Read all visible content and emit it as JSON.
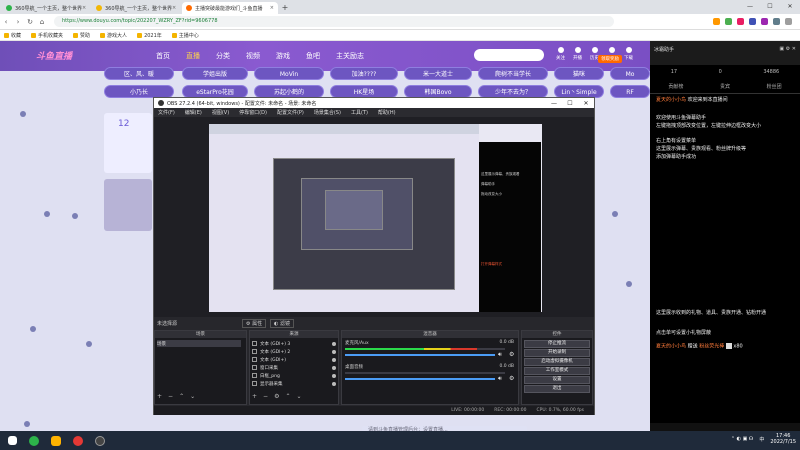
{
  "browser": {
    "tabs": [
      {
        "title": "360导航_一个主页，整个世界",
        "color": "#2db34a"
      },
      {
        "title": "360导航_一个主页，整个世界",
        "color": "#f2b705"
      },
      {
        "title": "主播突破最能游戏们_斗鱼直播",
        "color": "#ff6a00"
      }
    ],
    "url": "https://www.douyu.com/topic/202207_WZRY_ZF?rid=9606778",
    "bookmarks": [
      "收藏",
      "手机收藏夹",
      "赞助",
      "游戏大人",
      "2021年",
      "主播中心"
    ]
  },
  "site": {
    "logo": "斗鱼直播",
    "nav": [
      "首页",
      "直播",
      "分类",
      "视频",
      "游戏",
      "鱼吧",
      "主关励志"
    ],
    "nav_active_index": 1,
    "search_placeholder": "",
    "header_icons": [
      "关注",
      "开播",
      "历史",
      "任务",
      "下载"
    ],
    "open_label": "领取奖励",
    "tags_row1": [
      "区、风、暖",
      "学姐出版",
      "MoVin",
      "加油????",
      "米一大道士",
      "爬树不当学长",
      "猫咪",
      "Mo"
    ],
    "tags_row2": [
      "小乃长",
      "eStarPro花园",
      "苏起小鹤的",
      "HK星场",
      "韩国Bovo",
      "少年不去为？",
      "Lin丶Simple",
      "RF"
    ],
    "card_number": "12"
  },
  "chat": {
    "title": "冰霜助手",
    "stats": [
      "17",
      "0",
      "34886"
    ],
    "tabs": [
      "贡献榜",
      "贵宾",
      "粉丝团"
    ],
    "welcome_user": "夏天的小小鸟",
    "welcome_text": "欢迎来到本直播间",
    "messages": [
      "欢迎使用斗鱼弹幕助手",
      "左键拖拽顶部改变位置，左键拉伸边框改变大小",
      "右上角有设置菜单",
      "这里展示弹幕、贵族观看、粉丝牌升级等",
      "添加弹幕助手成功"
    ],
    "gift_note_1": "这里展示收到的礼物、道具、贵族开通、钻粉开通",
    "gift_note_2": "点击单可设置小礼物屏蔽",
    "gift_user": "夏天的小小鸟",
    "gift_action": "赠送",
    "gift_item": "粉丝荧光棒",
    "gift_count": "x80"
  },
  "obs": {
    "title": "OBS 27.2.4 (64-bit, windows) - 配置文件: 未命名 - 场景: 未命名",
    "menu": [
      "文件(F)",
      "编辑(E)",
      "视图(V)",
      "停靠窗口(D)",
      "配置文件(P)",
      "场景集合(S)",
      "工具(T)",
      "帮助(H)"
    ],
    "scene_hdr": "未选择源",
    "props_btn": "属性",
    "filter_btn": "滤镜",
    "scenes_title": "场景",
    "scenes": [
      "场景"
    ],
    "sources_title": "来源",
    "sources": [
      "文本 (GDI+) 3",
      "文本 (GDI+) 2",
      "文本 (GDI+)",
      "窗口采集",
      "白框_png",
      "显示器采集"
    ],
    "mixer_title": "混音器",
    "mixer_tracks": [
      {
        "name": "麦克风/Aux",
        "db": "0.0 dB",
        "level": 0.82
      },
      {
        "name": "桌面音频",
        "db": "0.0 dB",
        "level": 0.0
      }
    ],
    "controls_title": "控件",
    "controls": [
      "停止推流",
      "开始录制",
      "启动虚拟摄像机",
      "工作室模式",
      "设置",
      "退出"
    ],
    "status": [
      "LIVE: 00:00:00",
      "REC: 00:00:00",
      "CPU: 0.7%, 60.00 fps"
    ],
    "black_overlay": [
      "这里展示弹幕、贵族观看",
      "弹幕助手",
      "拖动改变大小",
      "打开弹幕样式"
    ]
  },
  "banner": "请到斗鱼直播管理后台：设置直播...",
  "taskbar": {
    "icons": [
      "#ffffff",
      "#1e90ff",
      "#2db34a",
      "#ffb300",
      "#e53935",
      "#444444"
    ],
    "time": "17:46",
    "date": "2022/7/15",
    "lang": "中"
  },
  "colors": {
    "accent": "#6d56c1",
    "header": "#7a4fc4",
    "chat_user": "#ff7b3a"
  }
}
